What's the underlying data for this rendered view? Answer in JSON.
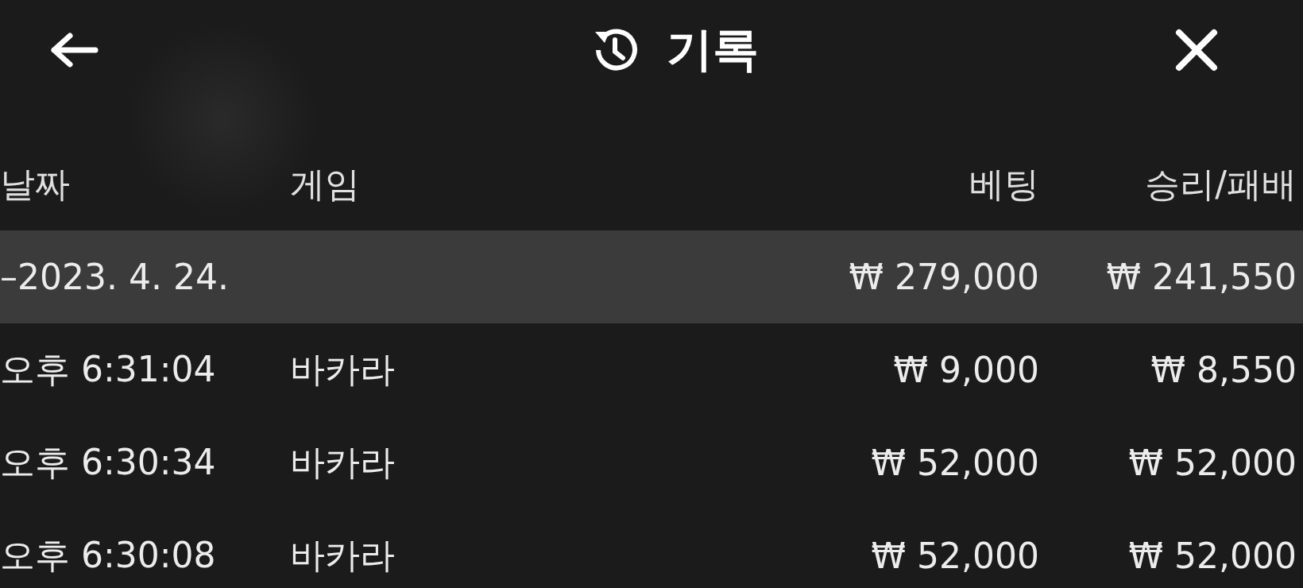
{
  "header": {
    "title": "기록"
  },
  "table": {
    "columns": [
      "날짜",
      "게임",
      "베팅",
      "승리/패배"
    ],
    "rows": [
      {
        "kind": "group",
        "date": "–2023. 4. 24.",
        "game": "",
        "bet": "₩ 279,000",
        "result": "₩ 241,550"
      },
      {
        "kind": "entry",
        "date": "오후 6:31:04",
        "game": "바카라",
        "bet": "₩ 9,000",
        "result": "₩ 8,550"
      },
      {
        "kind": "entry",
        "date": "오후 6:30:34",
        "game": "바카라",
        "bet": "₩ 52,000",
        "result": "₩ 52,000"
      },
      {
        "kind": "entry",
        "date": "오후 6:30:08",
        "game": "바카라",
        "bet": "₩ 52,000",
        "result": "₩ 52,000"
      }
    ]
  }
}
